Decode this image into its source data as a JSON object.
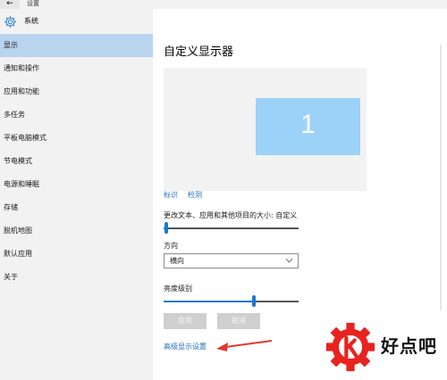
{
  "window": {
    "title": "设置",
    "back_glyph": "←"
  },
  "sidebar": {
    "home_label": "系统",
    "items": [
      {
        "label": "显示",
        "active": true
      },
      {
        "label": "通知和操作"
      },
      {
        "label": "应用和功能"
      },
      {
        "label": "多任务"
      },
      {
        "label": "平板电脑模式"
      },
      {
        "label": "节电模式"
      },
      {
        "label": "电源和睡眠"
      },
      {
        "label": "存储"
      },
      {
        "label": "脱机地图"
      },
      {
        "label": "默认应用"
      },
      {
        "label": "关于"
      }
    ]
  },
  "main": {
    "title": "自定义显示器",
    "monitor_number": "1",
    "identify_link": "标识",
    "detect_link": "检测",
    "scale_label": "更改文本、应用和其他项目的大小: 自定义",
    "scale_value": 0,
    "orientation_label": "方向",
    "orientation_value": "横向",
    "brightness_label": "亮度级别",
    "brightness_value": 0.67,
    "apply_button": "应用",
    "cancel_button": "取消",
    "advanced_link": "高级显示设置"
  },
  "watermark": {
    "text": "好点吧"
  },
  "colors": {
    "accent": "#1878d2",
    "sidebar_bg": "#f2f2f2",
    "active_item": "#b9d4ef",
    "monitor": "#9dd2f8",
    "link": "#1e6fbf",
    "annotation": "#e03a2f"
  }
}
